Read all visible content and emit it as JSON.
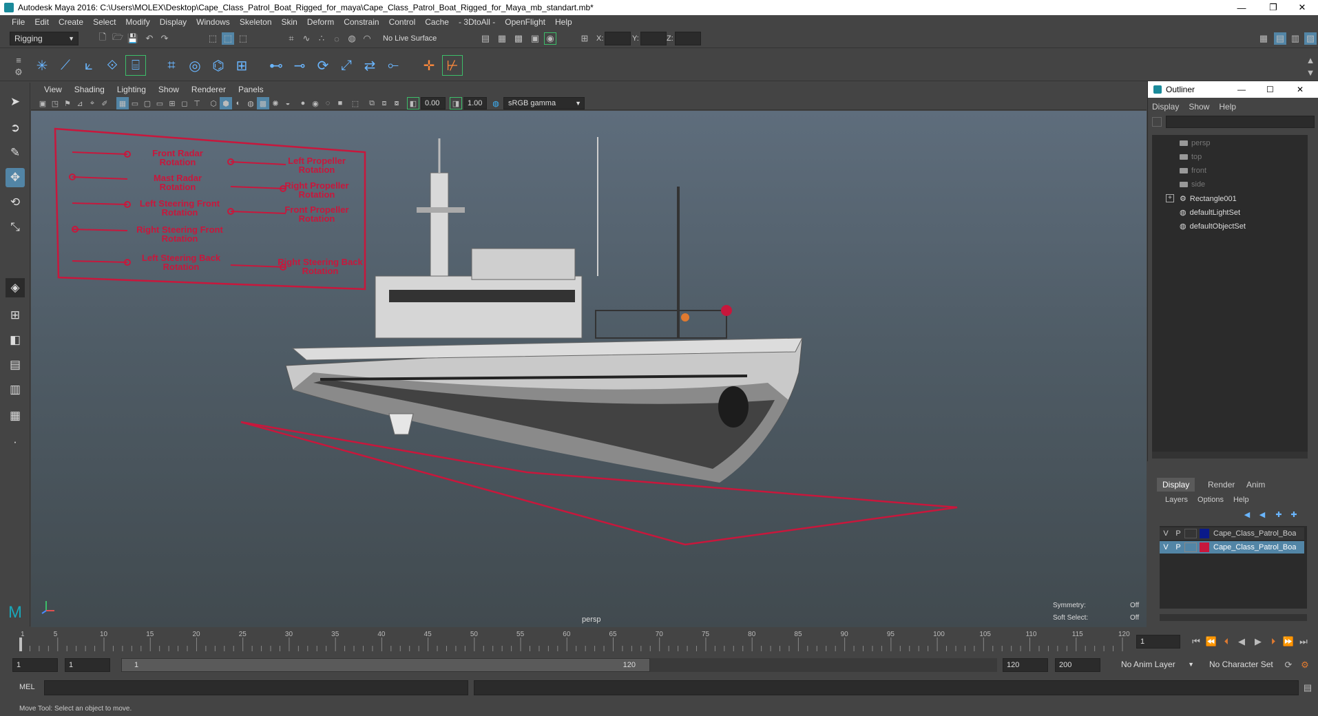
{
  "window": {
    "title": "Autodesk Maya 2016: C:\\Users\\MOLEX\\Desktop\\Cape_Class_Patrol_Boat_Rigged_for_maya\\Cape_Class_Patrol_Boat_Rigged_for_Maya_mb_standart.mb*"
  },
  "menu": [
    "File",
    "Edit",
    "Create",
    "Select",
    "Modify",
    "Display",
    "Windows",
    "Skeleton",
    "Skin",
    "Deform",
    "Constrain",
    "Control",
    "Cache",
    "- 3DtoAll -",
    "OpenFlight",
    "Help"
  ],
  "status_line": {
    "menuset": "Rigging",
    "live_surface": "No Live Surface",
    "x_label": "X:",
    "y_label": "Y:",
    "z_label": "Z:"
  },
  "panel_menu": [
    "View",
    "Shading",
    "Lighting",
    "Show",
    "Renderer",
    "Panels"
  ],
  "panel_toolbar": {
    "exposure": "0.00",
    "gamma": "1.00",
    "color_space": "sRGB gamma"
  },
  "viewport": {
    "camera_label": "persp",
    "symmetry_label": "Symmetry:",
    "symmetry_value": "Off",
    "soft_select_label": "Soft Select:",
    "soft_select_value": "Off",
    "annotations": {
      "front_radar": [
        "Front Radar",
        "Rotation"
      ],
      "mast_radar": [
        "Mast Radar",
        "Rotation"
      ],
      "left_steering_front": [
        "Left Steering Front",
        "Rotation"
      ],
      "right_steering_front": [
        "Right Steering Front",
        "Rotation"
      ],
      "left_steering_back": [
        "Left Steering Back",
        "Rotation"
      ],
      "left_propeller": [
        "Left Propeller",
        "Rotation"
      ],
      "right_propeller": [
        "Right Propeller",
        "Rotation"
      ],
      "front_propeller": [
        "Front Propeller",
        "Rotation"
      ],
      "right_steering_back": [
        "Right Steering Back",
        "Rotation"
      ]
    }
  },
  "outliner": {
    "title": "Outliner",
    "menu": [
      "Display",
      "Show",
      "Help"
    ],
    "items": [
      "persp",
      "top",
      "front",
      "side",
      "Rectangle001",
      "defaultLightSet",
      "defaultObjectSet"
    ]
  },
  "layer_editor": {
    "tabs": [
      "Display",
      "Render",
      "Anim"
    ],
    "menu": [
      "Layers",
      "Options",
      "Help"
    ],
    "rows": [
      {
        "v": "V",
        "p": "P",
        "name": "Cape_Class_Patrol_Boa",
        "color": "#0a1a8a"
      },
      {
        "v": "V",
        "p": "P",
        "name": "Cape_Class_Patrol_Boa",
        "color": "#c8173c"
      }
    ]
  },
  "time_slider": {
    "ticks": [
      "1",
      "5",
      "10",
      "15",
      "20",
      "25",
      "30",
      "35",
      "40",
      "45",
      "50",
      "55",
      "60",
      "65",
      "70",
      "75",
      "80",
      "85",
      "90",
      "95",
      "100",
      "105",
      "110",
      "115",
      "120"
    ],
    "current_frame": "1"
  },
  "range_slider": {
    "start": "1",
    "playback_start": "1",
    "range_start_label": "1",
    "range_end_label": "120",
    "playback_end": "120",
    "end": "200",
    "anim_layer": "No Anim Layer",
    "character_set": "No Character Set"
  },
  "command_line": {
    "label": "MEL"
  },
  "help_line": "Move Tool: Select an object to move."
}
